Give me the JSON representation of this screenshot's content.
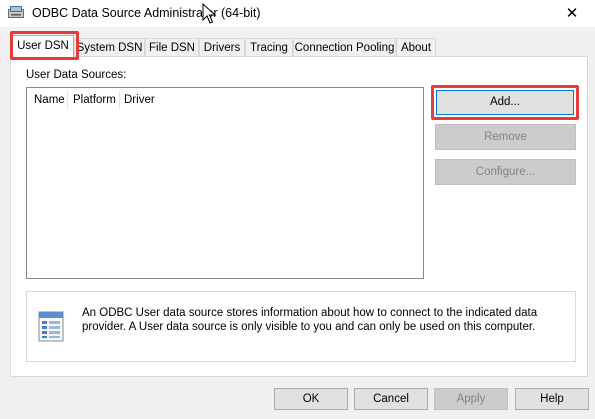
{
  "window": {
    "title": "ODBC Data Source Administrator (64-bit)",
    "close_glyph": "✕",
    "icon": "odbc-admin-icon"
  },
  "tabs": [
    {
      "label": "User DSN",
      "active": true
    },
    {
      "label": "System DSN"
    },
    {
      "label": "File DSN"
    },
    {
      "label": "Drivers"
    },
    {
      "label": "Tracing"
    },
    {
      "label": "Connection Pooling"
    },
    {
      "label": "About"
    }
  ],
  "user_dsn": {
    "section_label": "User Data Sources:",
    "columns": [
      "Name",
      "Platform",
      "Driver"
    ],
    "rows": [],
    "buttons": {
      "add": "Add...",
      "remove": "Remove",
      "configure": "Configure..."
    },
    "info_text": "An ODBC User data source stores information about how to connect to the indicated data provider.  A User data source is only visible to you and can only be used on this computer.",
    "info_icon": "data-sources-icon"
  },
  "footer": {
    "ok": "OK",
    "cancel": "Cancel",
    "apply": "Apply",
    "help": "Help"
  },
  "highlight_color": "#e8393b"
}
